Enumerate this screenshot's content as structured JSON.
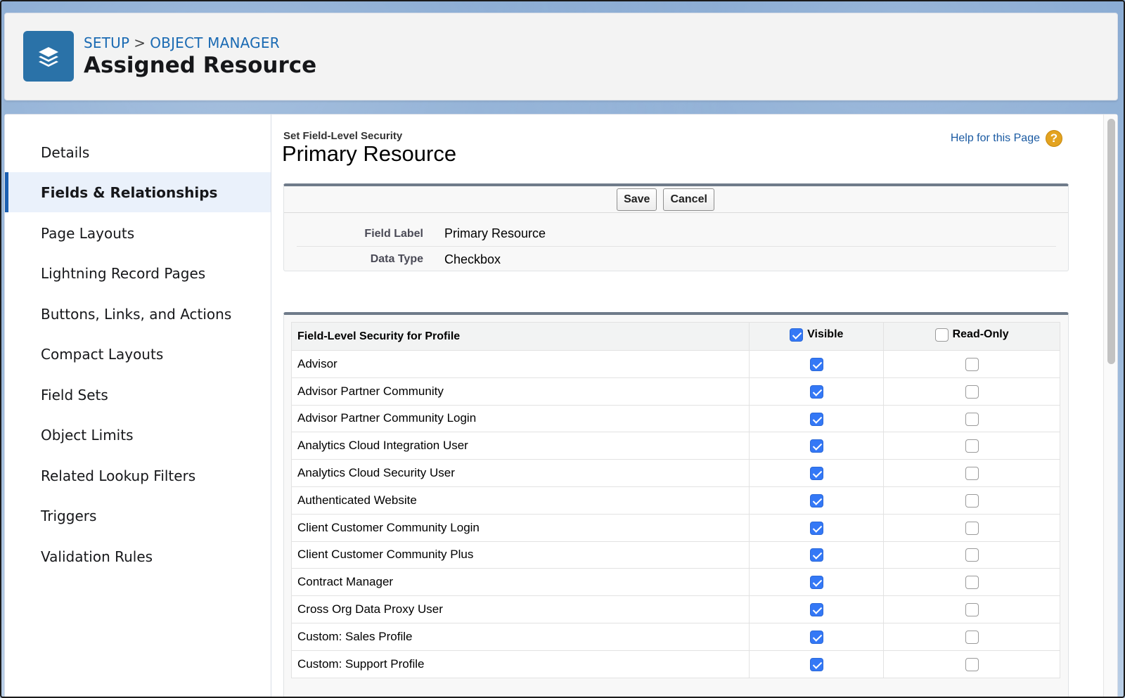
{
  "header": {
    "breadcrumb": {
      "setup": "SETUP",
      "separator": ">",
      "object_manager": "OBJECT MANAGER"
    },
    "title": "Assigned Resource",
    "icon": "stacked-layers-icon"
  },
  "sidebar": {
    "items": [
      {
        "label": "Details",
        "active": false
      },
      {
        "label": "Fields & Relationships",
        "active": true
      },
      {
        "label": "Page Layouts",
        "active": false
      },
      {
        "label": "Lightning Record Pages",
        "active": false
      },
      {
        "label": "Buttons, Links, and Actions",
        "active": false
      },
      {
        "label": "Compact Layouts",
        "active": false
      },
      {
        "label": "Field Sets",
        "active": false
      },
      {
        "label": "Object Limits",
        "active": false
      },
      {
        "label": "Related Lookup Filters",
        "active": false
      },
      {
        "label": "Triggers",
        "active": false
      },
      {
        "label": "Validation Rules",
        "active": false
      }
    ]
  },
  "content": {
    "subtitle": "Set Field-Level Security",
    "field_name": "Primary Resource",
    "help_link": "Help for this Page",
    "help_icon": "question-mark-icon",
    "buttons": {
      "save": "Save",
      "cancel": "Cancel"
    },
    "field_info": [
      {
        "label": "Field Label",
        "value": "Primary Resource"
      },
      {
        "label": "Data Type",
        "value": "Checkbox"
      }
    ]
  },
  "table": {
    "headers": {
      "profile": "Field-Level Security for Profile",
      "visible": "Visible",
      "read_only": "Read-Only"
    },
    "header_checks": {
      "visible": true,
      "read_only": false
    },
    "rows": [
      {
        "profile": "Advisor",
        "visible": true,
        "read_only": false
      },
      {
        "profile": "Advisor Partner Community",
        "visible": true,
        "read_only": false
      },
      {
        "profile": "Advisor Partner Community Login",
        "visible": true,
        "read_only": false
      },
      {
        "profile": "Analytics Cloud Integration User",
        "visible": true,
        "read_only": false
      },
      {
        "profile": "Analytics Cloud Security User",
        "visible": true,
        "read_only": false
      },
      {
        "profile": "Authenticated Website",
        "visible": true,
        "read_only": false
      },
      {
        "profile": "Client Customer Community Login",
        "visible": true,
        "read_only": false
      },
      {
        "profile": "Client Customer Community Plus",
        "visible": true,
        "read_only": false
      },
      {
        "profile": "Contract Manager",
        "visible": true,
        "read_only": false
      },
      {
        "profile": "Cross Org Data Proxy User",
        "visible": true,
        "read_only": false
      },
      {
        "profile": "Custom: Sales Profile",
        "visible": true,
        "read_only": false
      },
      {
        "profile": "Custom: Support Profile",
        "visible": true,
        "read_only": false
      }
    ]
  },
  "colors": {
    "accent": "#1b5fb1",
    "object_icon_bg": "#2a72a8",
    "checkbox_checked": "#3478f6",
    "help_icon": "#e3a320"
  }
}
